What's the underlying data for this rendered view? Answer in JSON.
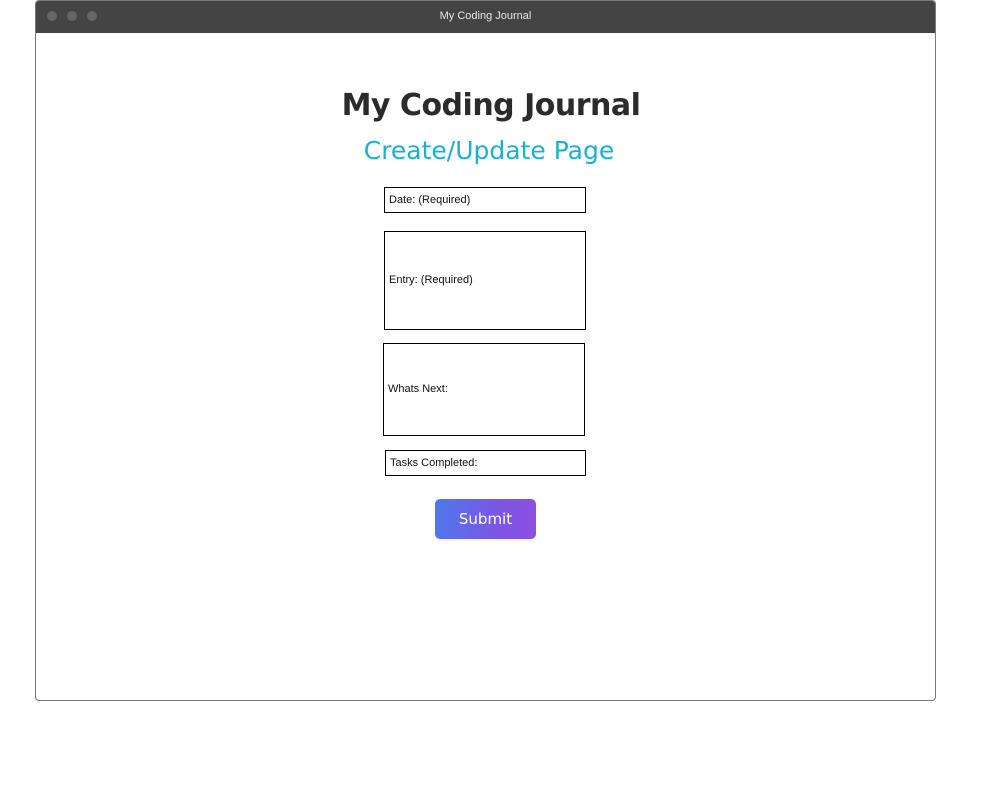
{
  "window": {
    "title": "My Coding Journal"
  },
  "page": {
    "heading": "My Coding Journal",
    "subheading": "Create/Update Page"
  },
  "form": {
    "date_label": "Date: (Required)",
    "entry_label": "Entry: (Required)",
    "whats_next_label": "Whats Next:",
    "tasks_completed_label": "Tasks Completed:",
    "submit_label": "Submit"
  },
  "colors": {
    "titlebar": "#444444",
    "subheading": "#1ab1d1",
    "button_gradient_start": "#4f78ec",
    "button_gradient_end": "#8e4fe2"
  }
}
